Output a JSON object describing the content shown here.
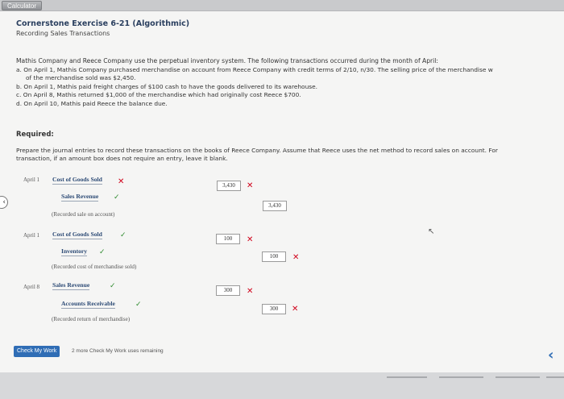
{
  "topbar": {
    "calculator_label": "Calculator"
  },
  "header": {
    "title": "Cornerstone Exercise 6-21 (Algorithmic)",
    "subtitle": "Recording Sales Transactions"
  },
  "problem": {
    "intro": "Mathis Company and Reece Company use the perpetual inventory system. The following transactions occurred during the month of April:",
    "items": [
      "a. On April 1, Mathis Company purchased merchandise on account from Reece Company with credit terms of 2/10, n/30. The selling price of the merchandise w",
      "of the merchandise sold was $2,450.",
      "b. On April 1, Mathis paid freight charges of $100 cash to have the goods delivered to its warehouse.",
      "c. On April 8, Mathis returned $1,000 of the merchandise which had originally cost Reece $700.",
      "d. On April 10, Mathis paid Reece the balance due."
    ]
  },
  "required": {
    "heading": "Required:",
    "lines": [
      "Prepare the journal entries to record these transactions on the books of Reece Company. Assume that Reece uses the net method to record sales on account. For",
      "transaction, if an amount box does not require an entry, leave it blank."
    ]
  },
  "journal": [
    {
      "date": "April 1",
      "debit_account": "Cost of Goods Sold",
      "debit_amount": "3,430",
      "credit_account": "Sales Revenue",
      "credit_amount": "3,430",
      "note": "(Recorded sale on account)"
    },
    {
      "date": "April 1",
      "debit_account": "Cost of Goods Sold",
      "debit_amount": "100",
      "credit_account": "Inventory",
      "credit_amount": "100",
      "note": "(Recorded cost of merchandise sold)"
    },
    {
      "date": "April 8",
      "debit_account": "Sales Revenue",
      "debit_amount": "300",
      "credit_account": "Accounts Receivable",
      "credit_amount": "300",
      "note": "(Recorded return of merchandise)"
    }
  ],
  "footer": {
    "check_button": "Check My Work",
    "remaining": "2 more Check My Work uses remaining"
  },
  "colors": {
    "accent": "#2f6db5",
    "error": "#d0021b",
    "correct": "#2e8b2e"
  }
}
